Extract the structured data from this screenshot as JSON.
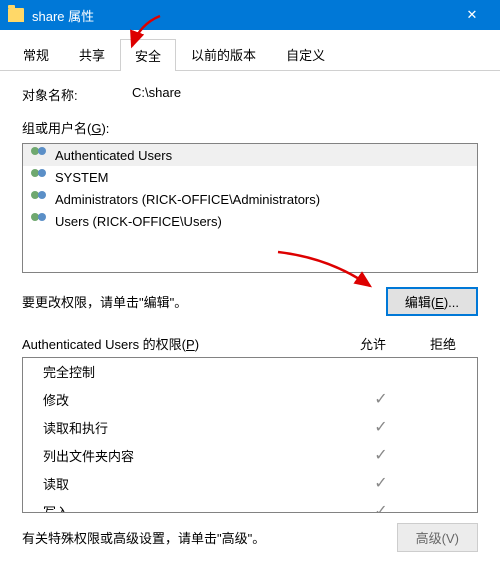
{
  "titlebar": {
    "title": "share 属性",
    "close": "✕"
  },
  "tabs": [
    {
      "label": "常规",
      "active": false
    },
    {
      "label": "共享",
      "active": false
    },
    {
      "label": "安全",
      "active": true
    },
    {
      "label": "以前的版本",
      "active": false
    },
    {
      "label": "自定义",
      "active": false
    }
  ],
  "object": {
    "label": "对象名称:",
    "value": "C:\\share"
  },
  "groups": {
    "label_prefix": "组或用户名(",
    "label_key": "G",
    "label_suffix": "):",
    "items": [
      {
        "text": "Authenticated Users",
        "selected": true
      },
      {
        "text": "SYSTEM",
        "selected": false
      },
      {
        "text": "Administrators (RICK-OFFICE\\Administrators)",
        "selected": false
      },
      {
        "text": "Users (RICK-OFFICE\\Users)",
        "selected": false
      }
    ]
  },
  "edit": {
    "hint": "要更改权限，请单击\"编辑\"。",
    "button_prefix": "编辑(",
    "button_key": "E",
    "button_suffix": ")..."
  },
  "permissions": {
    "header_name_prefix": "Authenticated Users 的权限(",
    "header_key": "P",
    "header_suffix": ")",
    "col_allow": "允许",
    "col_deny": "拒绝",
    "rows": [
      {
        "name": "完全控制",
        "allow": false,
        "deny": false
      },
      {
        "name": "修改",
        "allow": true,
        "deny": false
      },
      {
        "name": "读取和执行",
        "allow": true,
        "deny": false
      },
      {
        "name": "列出文件夹内容",
        "allow": true,
        "deny": false
      },
      {
        "name": "读取",
        "allow": true,
        "deny": false
      },
      {
        "name": "写入",
        "allow": true,
        "deny": false
      }
    ]
  },
  "footer": {
    "hint": "有关特殊权限或高级设置，请单击\"高级\"。",
    "button": "高级(V)"
  }
}
